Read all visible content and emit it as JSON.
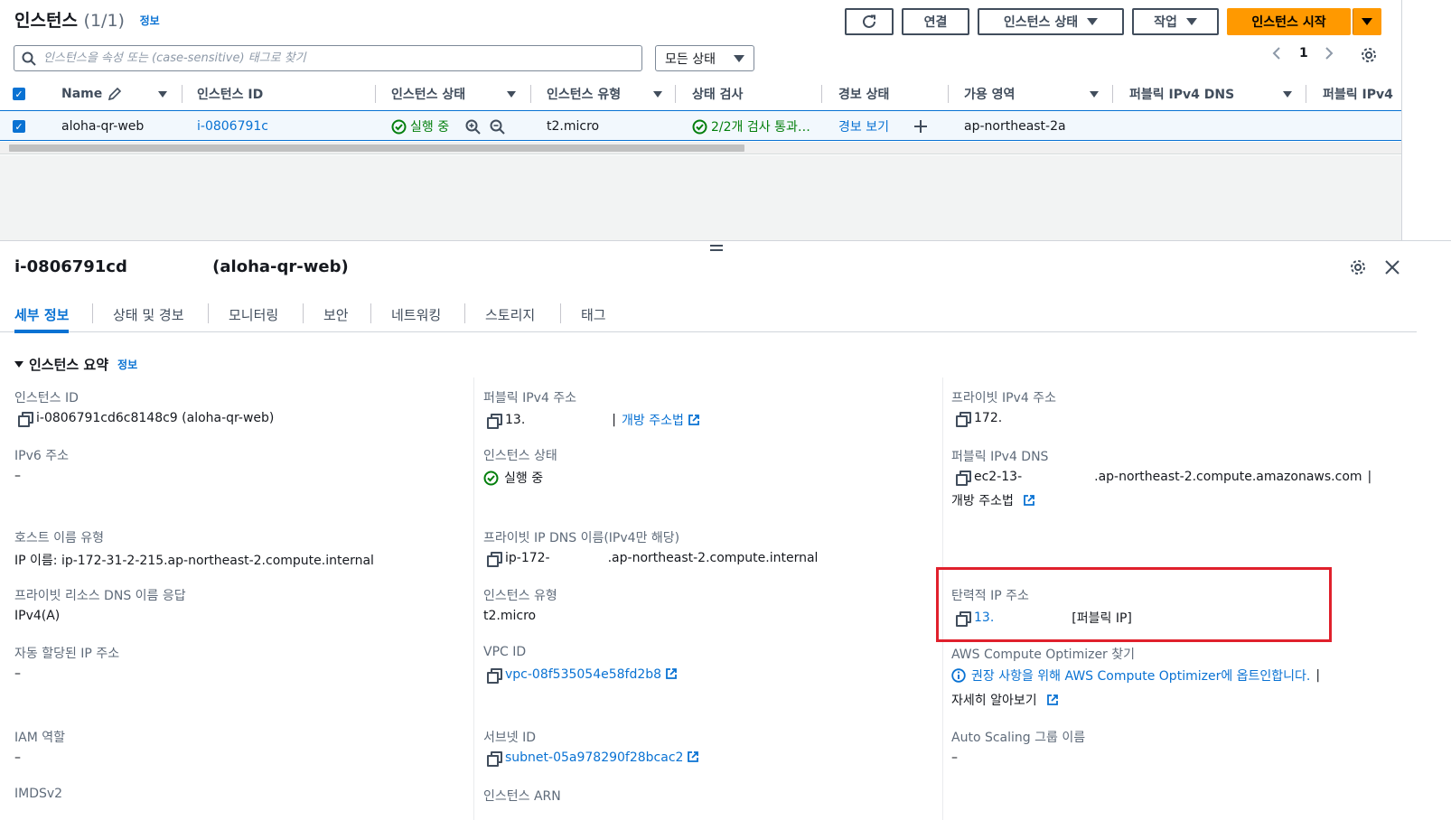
{
  "header": {
    "title": "인스턴스",
    "count": "(1/1)",
    "info": "정보",
    "buttons": {
      "connect": "연결",
      "instance_state": "인스턴스 상태",
      "actions": "작업",
      "launch": "인스턴스 시작"
    }
  },
  "search": {
    "placeholder": "인스턴스을 속성 또는 (case-sensitive) 태그로 찾기"
  },
  "state_filter": "모든 상태",
  "pager": {
    "page": "1"
  },
  "table": {
    "columns": [
      "Name",
      "인스턴스 ID",
      "인스턴스 상태",
      "인스턴스 유형",
      "상태 검사",
      "경보 상태",
      "가용 영역",
      "퍼블릭 IPv4 DNS",
      "퍼블릭 IPv4"
    ],
    "row": {
      "name": "aloha-qr-web",
      "id": "i-0806791c",
      "state": "실행 중",
      "type": "t2.micro",
      "checks": "2/2개 검사 통과…",
      "alarm": "경보 보기",
      "az": "ap-northeast-2a"
    }
  },
  "detail": {
    "id": "i-0806791cd",
    "name": "(aloha-qr-web)",
    "tabs": [
      "세부 정보",
      "상태 및 경보",
      "모니터링",
      "보안",
      "네트워킹",
      "스토리지",
      "태그"
    ],
    "section_title": "인스턴스 요약",
    "section_info": "정보",
    "fields": {
      "instance_id": {
        "label": "인스턴스 ID",
        "value": "i-0806791cd6c8148c9 (aloha-qr-web)"
      },
      "ipv6": {
        "label": "IPv6 주소",
        "value": "–"
      },
      "hostname_type": {
        "label": "호스트 이름 유형",
        "value": "IP 이름: ip-172-31-2-215.ap-northeast-2.compute.internal"
      },
      "private_dns_answer": {
        "label": "프라이빗 리소스 DNS 이름 응답",
        "value": "IPv4(A)"
      },
      "auto_ip": {
        "label": "자동 할당된 IP 주소",
        "value": "–"
      },
      "iam_role": {
        "label": "IAM 역할",
        "value": "–"
      },
      "imds": {
        "label": "IMDSv2"
      },
      "public_ipv4": {
        "label": "퍼블릭 IPv4 주소",
        "value": "13.",
        "sep": "|",
        "link": "개방 주소법"
      },
      "instance_state": {
        "label": "인스턴스 상태",
        "value": "실행 중"
      },
      "private_dns": {
        "label": "프라이빗 IP DNS 이름(IPv4만 해당)",
        "value_a": "ip-172-",
        "value_b": ".ap-northeast-2.compute.internal"
      },
      "instance_type": {
        "label": "인스턴스 유형",
        "value": "t2.micro"
      },
      "vpc_id": {
        "label": "VPC ID",
        "value": "vpc-08f535054e58fd2b8"
      },
      "subnet_id": {
        "label": "서브넷 ID",
        "value": "subnet-05a978290f28bcac2"
      },
      "instance_arn": {
        "label": "인스턴스 ARN"
      },
      "private_ipv4": {
        "label": "프라이빗 IPv4 주소",
        "value": "172."
      },
      "public_dns": {
        "label": "퍼블릭 IPv4 DNS",
        "value_a": "ec2-13-",
        "value_b": ".ap-northeast-2.compute.amazonaws.com",
        "sep": "|",
        "link": "개방 주소법"
      },
      "elastic_ip": {
        "label": "탄력적 IP 주소",
        "value": "13.",
        "suffix": "[퍼블릭 IP]"
      },
      "optimizer": {
        "label": "AWS Compute Optimizer 찾기",
        "text": "권장 사항을 위해 AWS Compute Optimizer에 옵트인합니다.",
        "sep": "|",
        "learn_more": "자세히 알아보기"
      },
      "asg_name": {
        "label": "Auto Scaling 그룹 이름",
        "value": "–"
      }
    }
  },
  "colors": {
    "accent": "#0972d3",
    "primary_button": "#ff9900",
    "success": "#037f0c",
    "highlight_box": "#e0202c"
  }
}
